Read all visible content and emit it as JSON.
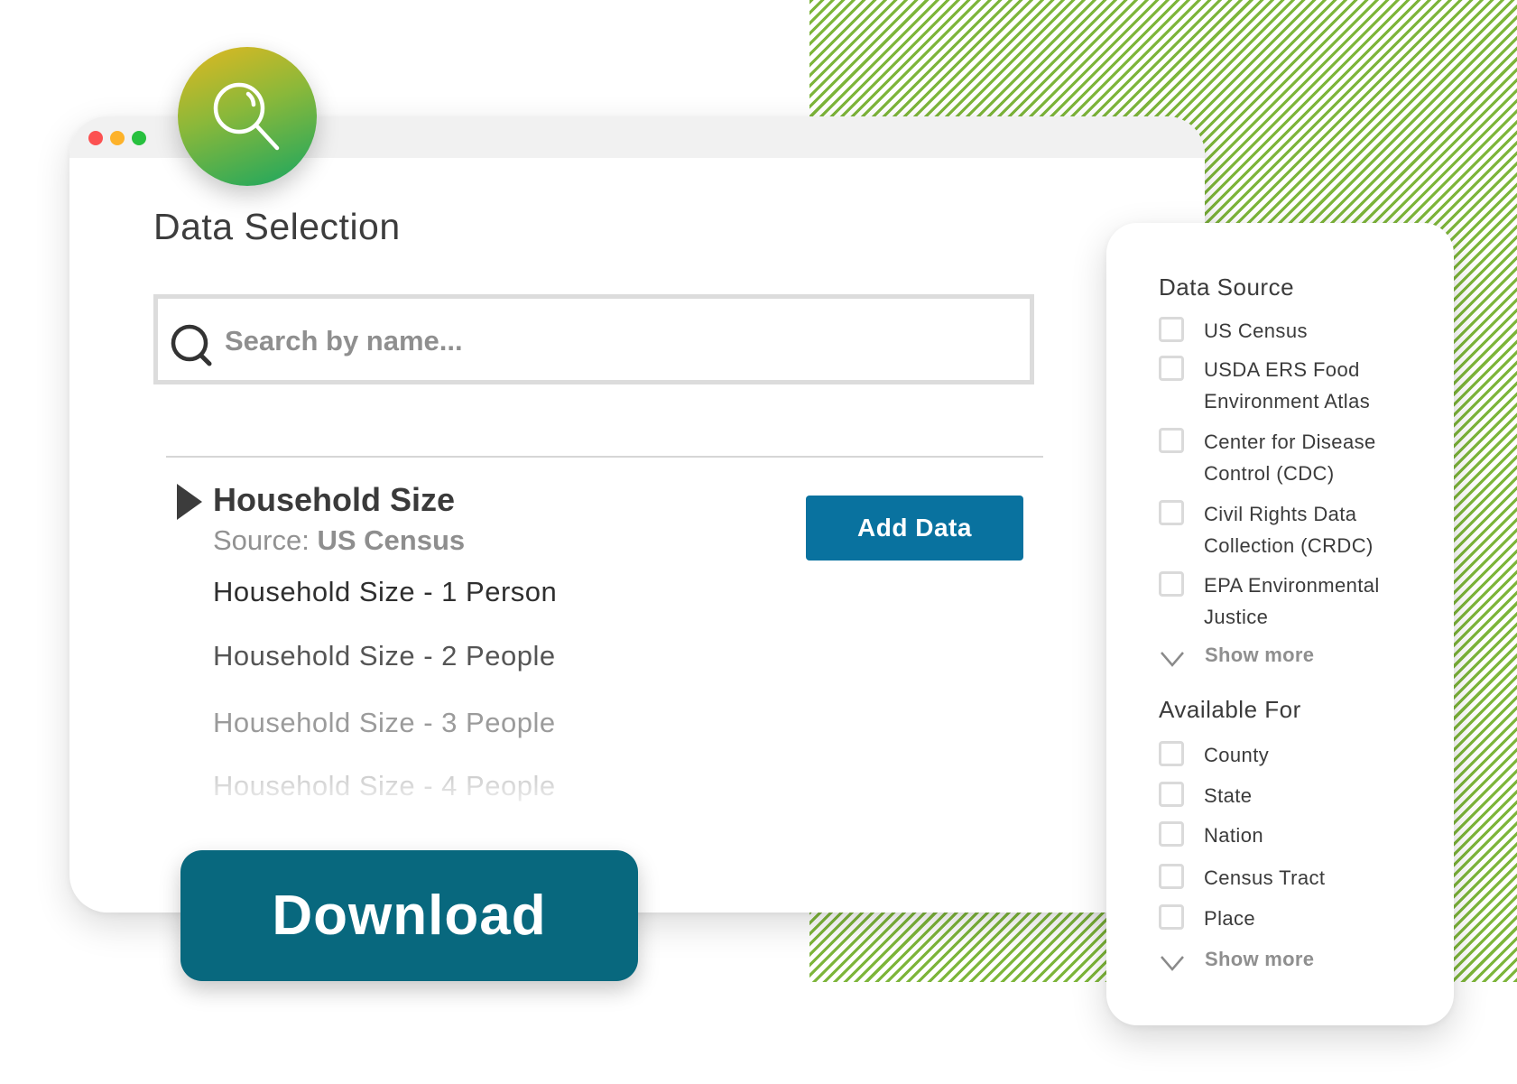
{
  "colors": {
    "hatch_green": "#7db53a",
    "add_data_button": "#09729f",
    "download_button": "#08687e",
    "window_dot_red": "#fc5151",
    "window_dot_yellow": "#fdb22a",
    "window_dot_green": "#27c03e",
    "badge_gradient": [
      "#e2b820",
      "#8ab83a",
      "#17a661"
    ]
  },
  "window": {
    "controls": [
      "close",
      "minimize",
      "maximize"
    ],
    "badge_icon": "magnifier-icon"
  },
  "page_title": "Data Selection",
  "search": {
    "icon": "search-icon",
    "value": "",
    "placeholder": "Search by name..."
  },
  "result": {
    "expand_icon": "triangle-right-icon",
    "title": "Household Size",
    "source_label": "Source:",
    "source_value": "US Census",
    "add_button": "Add Data",
    "variables": [
      "Household Size - 1 Person",
      "Household Size - 2 People",
      "Household Size - 3 People",
      "Household Size - 4 People"
    ]
  },
  "download_button": "Download",
  "filters": {
    "data_source": {
      "heading": "Data Source",
      "options": [
        {
          "label": "US Census",
          "checked": false
        },
        {
          "label": "USDA ERS Food Environment Atlas",
          "checked": false
        },
        {
          "label": "Center for Disease Control (CDC)",
          "checked": false
        },
        {
          "label": "Civil Rights Data Collection (CRDC)",
          "checked": false
        },
        {
          "label": "EPA Environmental Justice",
          "checked": false
        }
      ],
      "show_more": "Show more"
    },
    "available_for": {
      "heading": "Available For",
      "options": [
        {
          "label": "County",
          "checked": false
        },
        {
          "label": "State",
          "checked": false
        },
        {
          "label": "Nation",
          "checked": false
        },
        {
          "label": "Census Tract",
          "checked": false
        },
        {
          "label": "Place",
          "checked": false
        }
      ],
      "show_more": "Show more"
    }
  }
}
